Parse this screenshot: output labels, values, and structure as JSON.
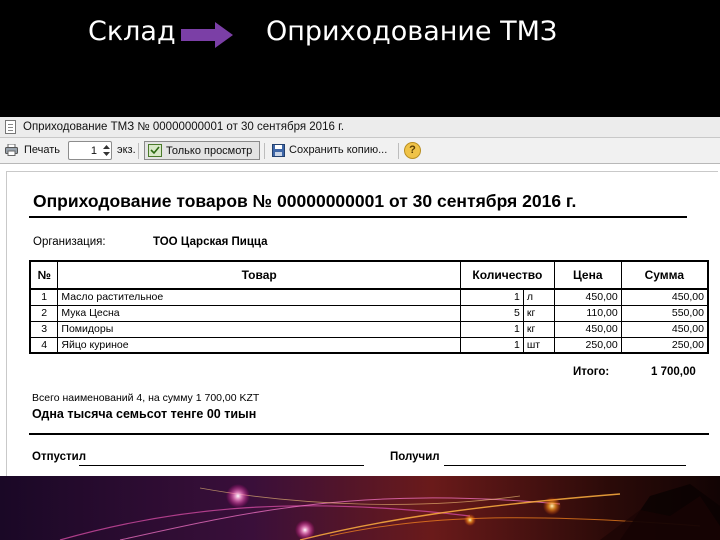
{
  "slide": {
    "left_label": "Склад",
    "right_label": "Оприходование ТМЗ",
    "arrow_color": "#7b3fa6"
  },
  "window": {
    "title": "Оприходование ТМЗ № 00000000001 от 30 сентября 2016 г."
  },
  "toolbar": {
    "print_label": "Печать",
    "copies_value": "1",
    "copies_unit": "экз.",
    "view_only_label": "Только просмотр",
    "save_copy_label": "Сохранить копию...",
    "help_symbol": "?"
  },
  "document": {
    "heading": "Оприходование товаров № 00000000001 от 30 сентября 2016 г.",
    "org_label": "Организация:",
    "org_value": "ТОО Царская Пицца",
    "columns": {
      "num": "№",
      "item": "Товар",
      "qty": "Количество",
      "price": "Цена",
      "sum": "Сумма"
    },
    "rows": [
      {
        "num": "1",
        "name": "Масло растительное",
        "qty": "1",
        "unit": "л",
        "price": "450,00",
        "sum": "450,00"
      },
      {
        "num": "2",
        "name": "Мука Цесна",
        "qty": "5",
        "unit": "кг",
        "price": "110,00",
        "sum": "550,00"
      },
      {
        "num": "3",
        "name": "Помидоры",
        "qty": "1",
        "unit": "кг",
        "price": "450,00",
        "sum": "450,00"
      },
      {
        "num": "4",
        "name": "Яйцо куриное",
        "qty": "1",
        "unit": "шт",
        "price": "250,00",
        "sum": "250,00"
      }
    ],
    "total_label": "Итого:",
    "total_value": "1 700,00",
    "summary_line": "Всего наименований 4, на сумму 1 700,00 KZT",
    "amount_words": "Одна тысяча семьсот тенге 00 тиын",
    "released_label": "Отпустил",
    "received_label": "Получил"
  }
}
